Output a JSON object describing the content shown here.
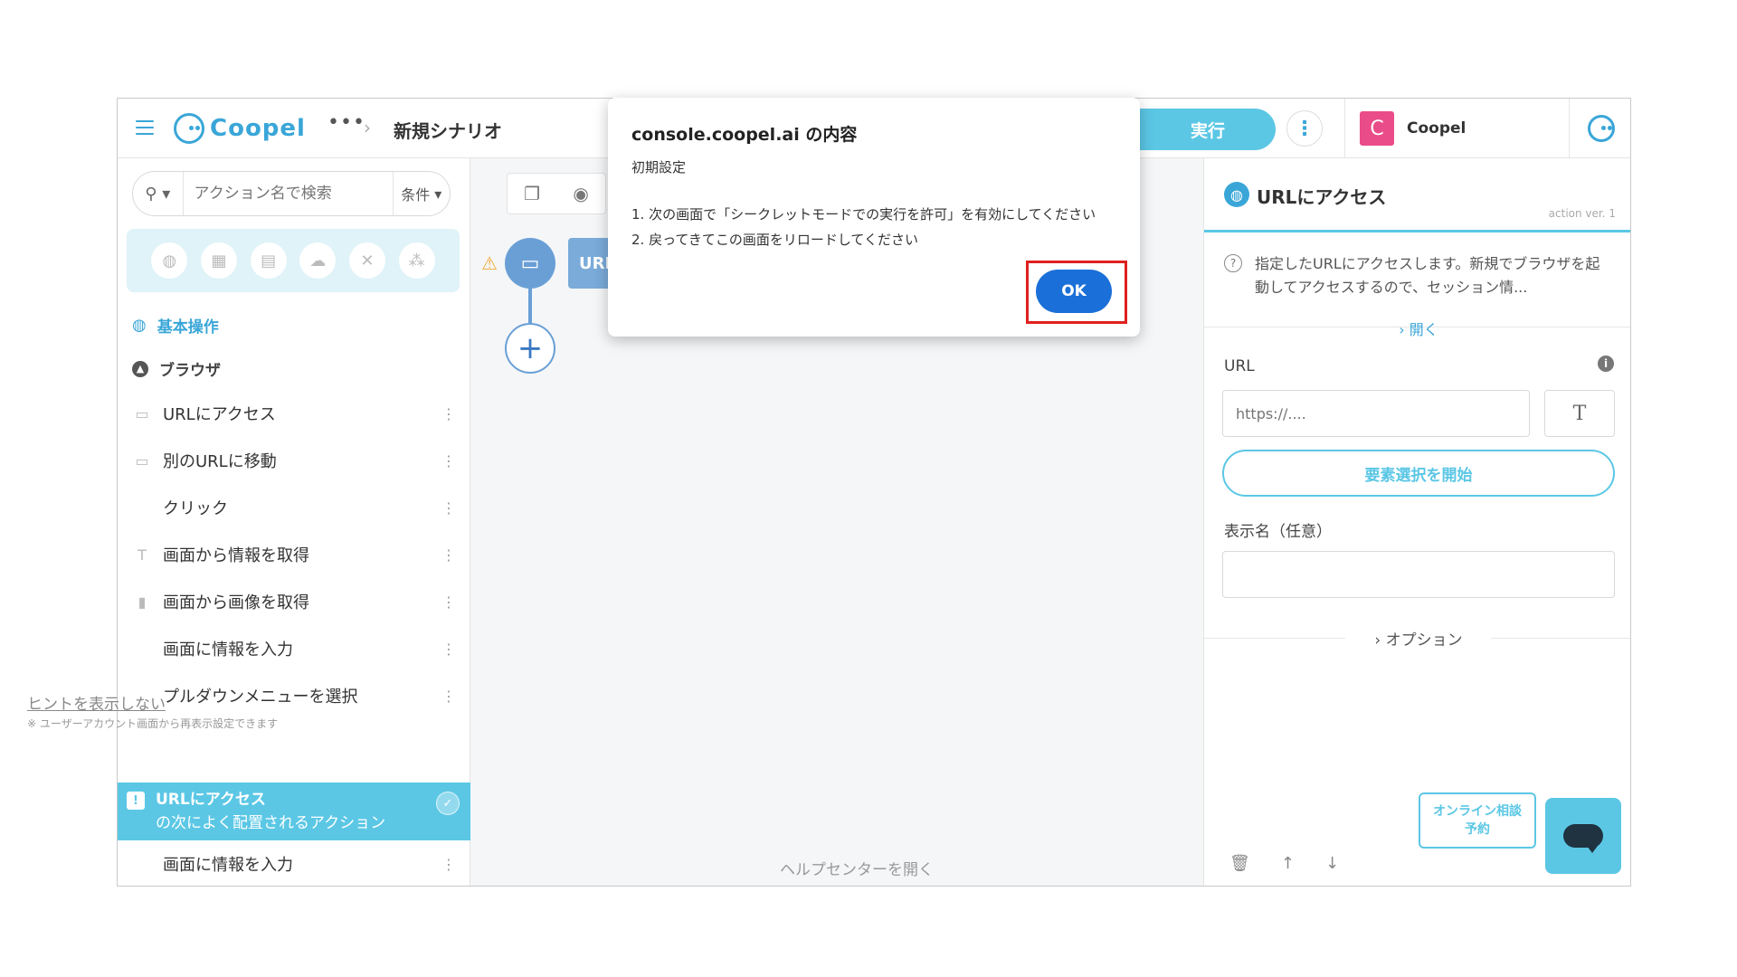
{
  "header": {
    "logo_text": "Coopel",
    "more_icon": "ellipsis-icon",
    "breadcrumb_sep": "›",
    "scenario_title": "新規シナリオ",
    "run_label": "実行",
    "account_initial": "C",
    "account_name": "Coopel"
  },
  "sidebar": {
    "search_placeholder": "アクション名で検索",
    "condition_label": "条件",
    "category_icons": [
      "globe-icon",
      "excel-icon",
      "file-icon",
      "cloud-icon",
      "tools-icon",
      "network-icon"
    ],
    "section_basic": "基本操作",
    "section_browser": "ブラウザ",
    "items": [
      {
        "label": "URLにアクセス",
        "icon": "browser-window-icon",
        "glyph": "▭"
      },
      {
        "label": "別のURLに移動",
        "icon": "browser-window-icon",
        "glyph": "▭"
      },
      {
        "label": "クリック",
        "icon": "cursor-icon",
        "glyph": ""
      },
      {
        "label": "画面から情報を取得",
        "icon": "text-icon",
        "glyph": "T"
      },
      {
        "label": "画面から画像を取得",
        "icon": "file-icon",
        "glyph": "▮"
      },
      {
        "label": "画面に情報を入力",
        "icon": "input-icon",
        "glyph": ""
      },
      {
        "label": "プルダウンメニューを選択",
        "icon": "dropdown-icon",
        "glyph": ""
      }
    ],
    "hint": {
      "title": "URLにアクセス",
      "subtitle": "の次によく配置されるアクション"
    },
    "hint_item": "画面に情報を入力",
    "hint_hide_link": "ヒントを表示しない",
    "hint_note": "※ ユーザーアカウント画面から再表示設定できます"
  },
  "canvas": {
    "node_label": "URL",
    "help_link": "ヘルプセンターを開く"
  },
  "right_panel": {
    "title": "URLにアクセス",
    "version": "action ver. 1",
    "description": "指定したURLにアクセスします。新規でブラウザを起動してアクセスするので、セッション情...",
    "open_link": "› 開く",
    "url_label": "URL",
    "url_placeholder": "https://....",
    "t_button": "T",
    "select_element_button": "要素選択を開始",
    "display_name_label": "表示名（任意）",
    "option_label": "› オプション"
  },
  "consult": {
    "line1": "オンライン相談",
    "line2": "予約"
  },
  "dialog": {
    "title": "console.coopel.ai の内容",
    "subtitle": "初期設定",
    "line1": "1. 次の画面で「シークレットモードでの実行を許可」を有効にしてください",
    "line2": "2. 戻ってきてこの画面をリロードしてください",
    "ok_label": "OK"
  },
  "colors": {
    "accent": "#5bc7e5",
    "brand": "#3aa6d8",
    "ok_button": "#1b6fd8",
    "highlight_frame": "#e0201f"
  }
}
